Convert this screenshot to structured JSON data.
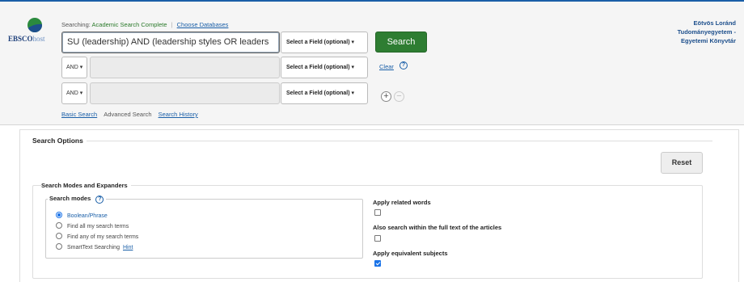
{
  "branding": {
    "logo_main": "EBSCO",
    "logo_suffix": "host",
    "institution": [
      "Eötvös Loránd",
      "Tudományegyetem -",
      "Egyetemi Könyvtár"
    ]
  },
  "search": {
    "searching_label": "Searching:",
    "database": "Academic Search Complete",
    "choose_databases": "Choose Databases",
    "query": "SU (leadership) AND (leadership styles OR leaders",
    "field_placeholder": "Select a Field (optional) ▾",
    "search_button": "Search",
    "clear": "Clear",
    "rows": [
      {
        "operator": "AND ▾",
        "value": "",
        "field": "Select a Field (optional) ▾"
      },
      {
        "operator": "AND ▾",
        "value": "",
        "field": "Select a Field (optional) ▾"
      }
    ]
  },
  "nav": {
    "basic_search": "Basic Search",
    "advanced_search": "Advanced Search",
    "search_history": "Search History"
  },
  "options": {
    "title": "Search Options",
    "reset": "Reset",
    "modes_section_title": "Search Modes and Expanders",
    "search_modes_label": "Search modes",
    "modes": [
      {
        "label": "Boolean/Phrase",
        "checked": true
      },
      {
        "label": "Find all my search terms",
        "checked": false
      },
      {
        "label": "Find any of my search terms",
        "checked": false
      },
      {
        "label": "SmartText Searching",
        "checked": false,
        "hint": "Hint"
      }
    ],
    "expanders": [
      {
        "label": "Apply related words",
        "checked": false
      },
      {
        "label": "Also search within the full text of the articles",
        "checked": false
      },
      {
        "label": "Apply equivalent subjects",
        "checked": true
      }
    ]
  },
  "colors": {
    "search_button": "#2e7d32",
    "link": "#1a5fa8",
    "institution": "#1d4f8c",
    "database": "#2b7a2b"
  }
}
